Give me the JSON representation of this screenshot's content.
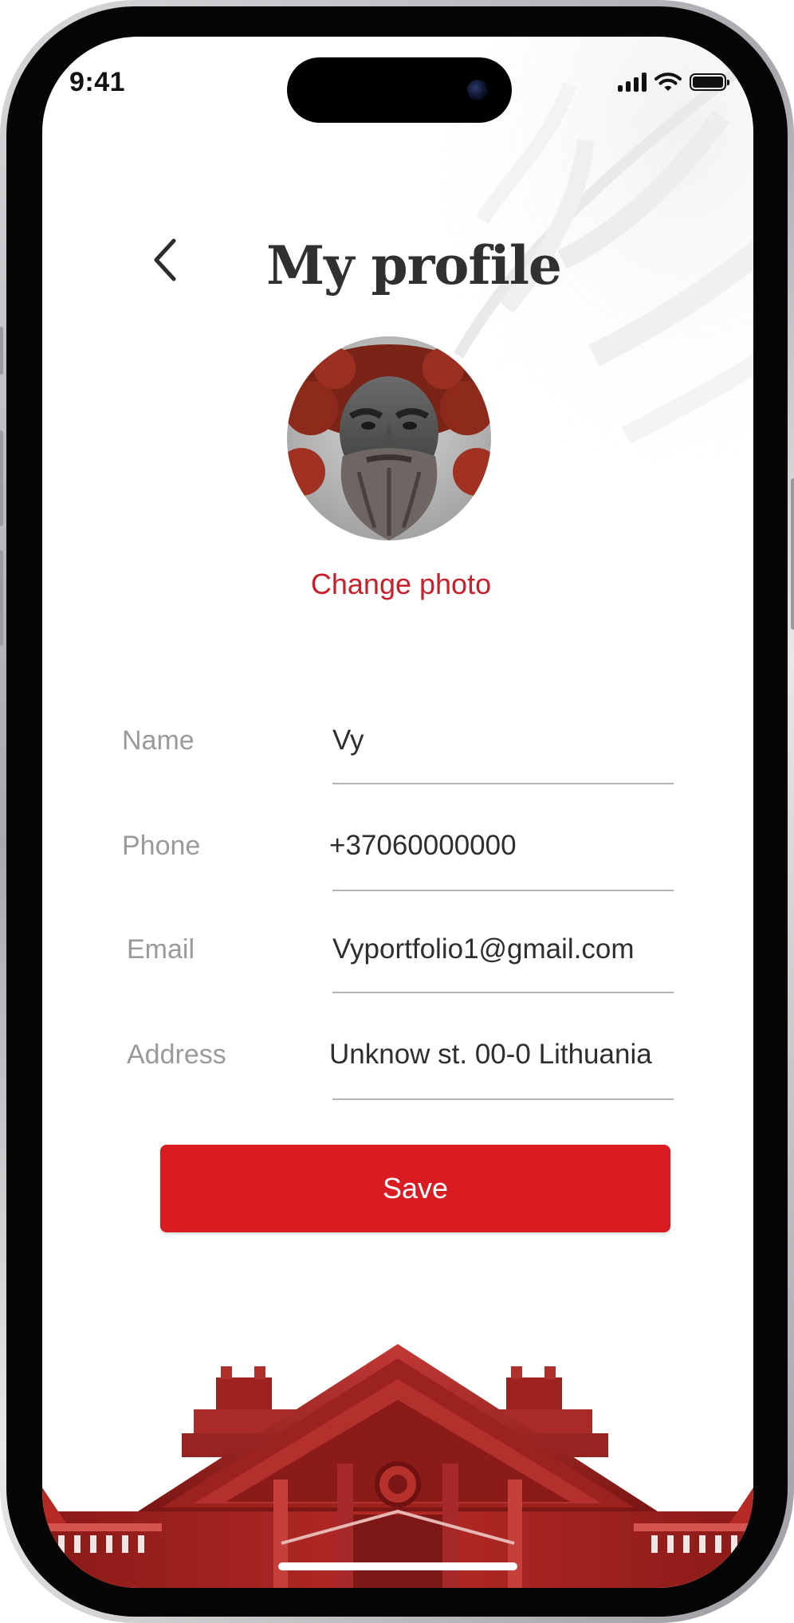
{
  "status_bar": {
    "time": "9:41",
    "signal_icon": "cellular-signal-icon",
    "wifi_icon": "wifi-icon",
    "battery_icon": "battery-icon"
  },
  "header": {
    "back_icon": "chevron-left-icon",
    "title": "My profile"
  },
  "profile": {
    "avatar": "bearded-statue-portrait",
    "change_photo_label": "Change photo"
  },
  "form": {
    "fields": [
      {
        "label": "Name",
        "value": "Vy"
      },
      {
        "label": "Phone",
        "value": "+37060000000"
      },
      {
        "label": "Email",
        "value": "Vyportfolio1@gmail.com"
      },
      {
        "label": "Address",
        "value": "Unknow st. 00-0 Lithuania"
      }
    ],
    "save_label": "Save"
  },
  "colors": {
    "accent": "#d91b22",
    "link": "#c8202a",
    "title": "#303030",
    "label": "#9a9a9a",
    "value": "#2e2e2e",
    "underline": "#b4b4b4"
  }
}
